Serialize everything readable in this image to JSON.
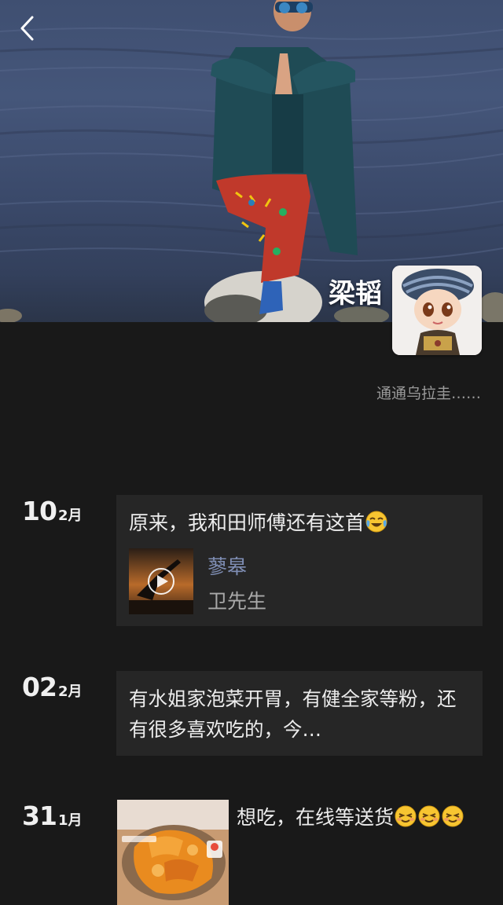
{
  "header": {
    "back_icon": "chevron-left-icon",
    "nickname": "梁韬",
    "signature": "通通乌拉圭……"
  },
  "posts": [
    {
      "day": "10",
      "month": "2月",
      "text": "原来，我和田师傅还有这首",
      "emoji": "crying-laughing-face",
      "music": {
        "title": "蓼皋",
        "artist": "卫先生"
      }
    },
    {
      "day": "02",
      "month": "2月",
      "text": "有水姐家泡菜开胃，有健全家等粉，还有很多喜欢吃的，今…"
    },
    {
      "day": "31",
      "month": "1月",
      "text": "想吃，在线等送货",
      "emoji": "sleepy-smile-face"
    }
  ],
  "colors": {
    "background": "#191919",
    "card": "#262626",
    "link": "#7f8eb4",
    "secondary_text": "#9a9a9a"
  }
}
